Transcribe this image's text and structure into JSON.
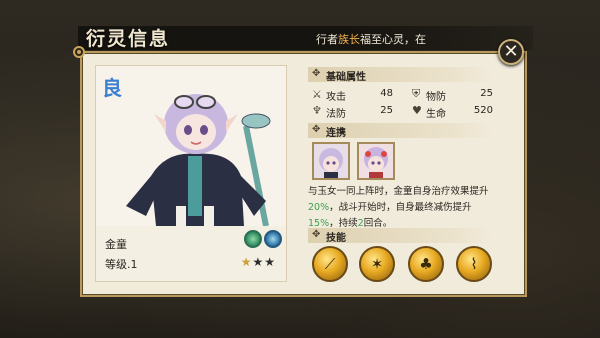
{
  "window": {
    "title": "衍灵信息"
  },
  "ticker": {
    "prefix": "行者",
    "highlight": "族长",
    "suffix": "福至心灵，在"
  },
  "portrait": {
    "faction_glyph": "良",
    "name": "金童",
    "level": "等级.1",
    "element_icons": [
      "wind-element-icon",
      "water-element-icon"
    ],
    "stars_total": 3,
    "stars_filled": 1
  },
  "basic_attrs": {
    "header": "基础属性",
    "stats": [
      {
        "icon": "sword-icon",
        "label": "攻击",
        "value": "48"
      },
      {
        "icon": "shield-icon",
        "label": "物防",
        "value": "25"
      },
      {
        "icon": "magic-defense-icon",
        "label": "法防",
        "value": "25"
      },
      {
        "icon": "heart-icon",
        "label": "生命",
        "value": "520"
      }
    ]
  },
  "link": {
    "header": "连携",
    "thumbnails": [
      "linked-character-1",
      "linked-character-2"
    ],
    "desc_1": "与玉女一同上阵时，金童自身治疗效果提升",
    "pct_1": "20%",
    "desc_2": "，战斗开始时，自身最终减伤提升",
    "pct_2": "15%",
    "desc_3": "，持续",
    "turns": "2",
    "desc_4": "回合。"
  },
  "skills": {
    "header": "技能",
    "items": [
      "skill-1-icon",
      "skill-2-icon",
      "skill-3-icon",
      "skill-4-icon"
    ]
  },
  "colors": {
    "accent_gold": "#c8a13a",
    "highlight_green": "#3aa252",
    "ticker_highlight": "#f2b04a",
    "faction_blue": "#3b7fd0"
  },
  "close": {
    "label": "✕"
  }
}
